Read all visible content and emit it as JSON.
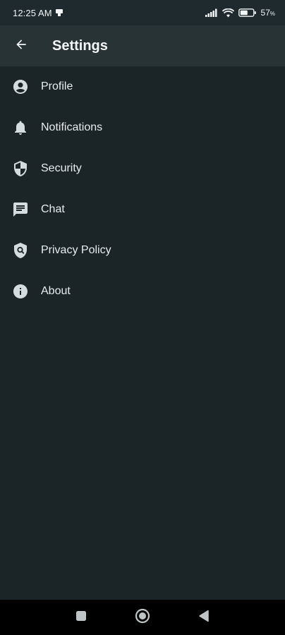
{
  "status_bar": {
    "time": "12:25 AM",
    "battery": "57"
  },
  "app_bar": {
    "title": "Settings",
    "back_icon": "arrow-back-icon"
  },
  "settings": {
    "items": [
      {
        "label": "Profile",
        "icon": "account-circle-icon"
      },
      {
        "label": "Notifications",
        "icon": "bell-icon"
      },
      {
        "label": "Security",
        "icon": "shield-icon"
      },
      {
        "label": "Chat",
        "icon": "chat-icon"
      },
      {
        "label": "Privacy Policy",
        "icon": "privacy-shield-icon"
      },
      {
        "label": "About",
        "icon": "info-icon"
      }
    ]
  },
  "nav_bar": {
    "recents_icon": "square-icon",
    "home_icon": "circle-icon",
    "back_icon": "triangle-back-icon"
  },
  "colors": {
    "background": "#1b2427",
    "app_bar": "#283336",
    "text": "#e8eded",
    "icon": "#d5dcdd"
  }
}
